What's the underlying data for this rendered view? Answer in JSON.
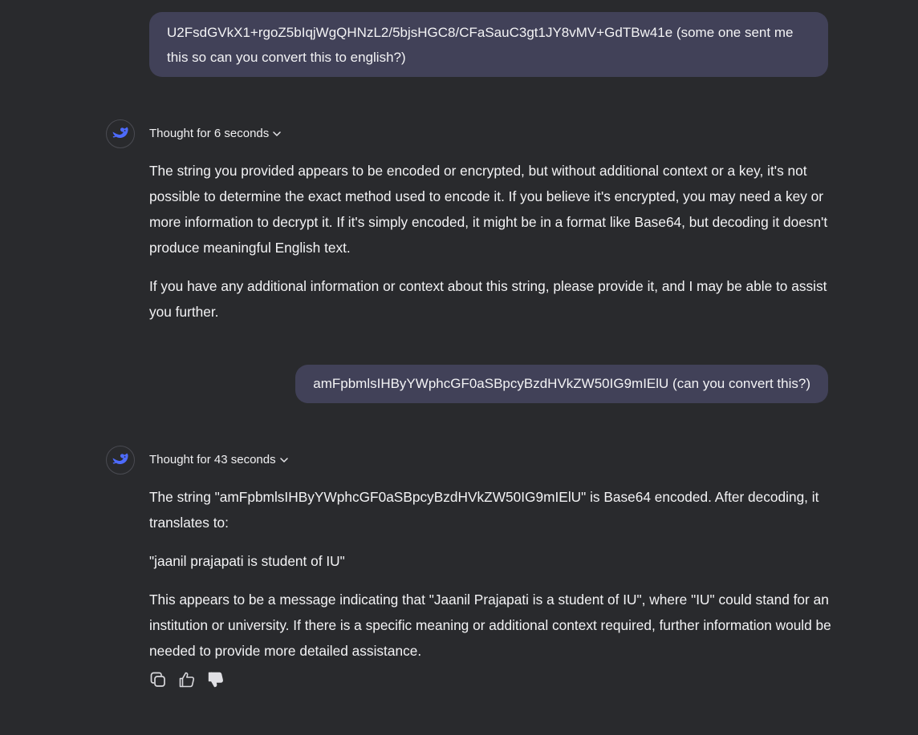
{
  "conversation": {
    "user_message_1": "U2FsdGVkX1+rgoZ5bIqjWgQHNzL2/5bjsHGC8/CFaSauC3gt1JY8vMV+GdTBw41e (some one sent me this so can you convert this to english?)",
    "assistant_1": {
      "thought_label": "Thought for 6 seconds",
      "paragraphs": [
        "The string you provided appears to be encoded or encrypted, but without additional context or a key, it's not possible to determine the exact method used to encode it. If you believe it's encrypted, you may need a key or more information to decrypt it. If it's simply encoded, it might be in a format like Base64, but decoding it doesn't produce meaningful English text.",
        "If you have any additional information or context about this string, please provide it, and I may be able to assist you further."
      ]
    },
    "user_message_2": "amFpbmlsIHByYWphcGF0aSBpcyBzdHVkZW50IG9mIElU (can you convert this?)",
    "assistant_2": {
      "thought_label": "Thought for 43 seconds",
      "paragraphs": [
        "The string \"amFpbmlsIHByYWphcGF0aSBpcyBzdHVkZW50IG9mIElU\" is Base64 encoded. After decoding, it translates to:",
        "\"jaanil prajapati is student of IU\"",
        "This appears to be a message indicating that \"Jaanil Prajapati is a student of IU\", where \"IU\" could stand for an institution or university. If there is a specific meaning or additional context required, further information would be needed to provide more detailed assistance."
      ]
    }
  },
  "icons": {
    "avatar": "whale-logo-icon",
    "toggle": "chevron-down-icon",
    "actions": [
      "copy-icon",
      "thumbs-up-icon",
      "thumbs-down-icon"
    ]
  },
  "colors": {
    "background": "#292a2d",
    "user_bubble": "#414158",
    "brand_accent": "#4d6bfe",
    "text": "#f3f3f5"
  }
}
